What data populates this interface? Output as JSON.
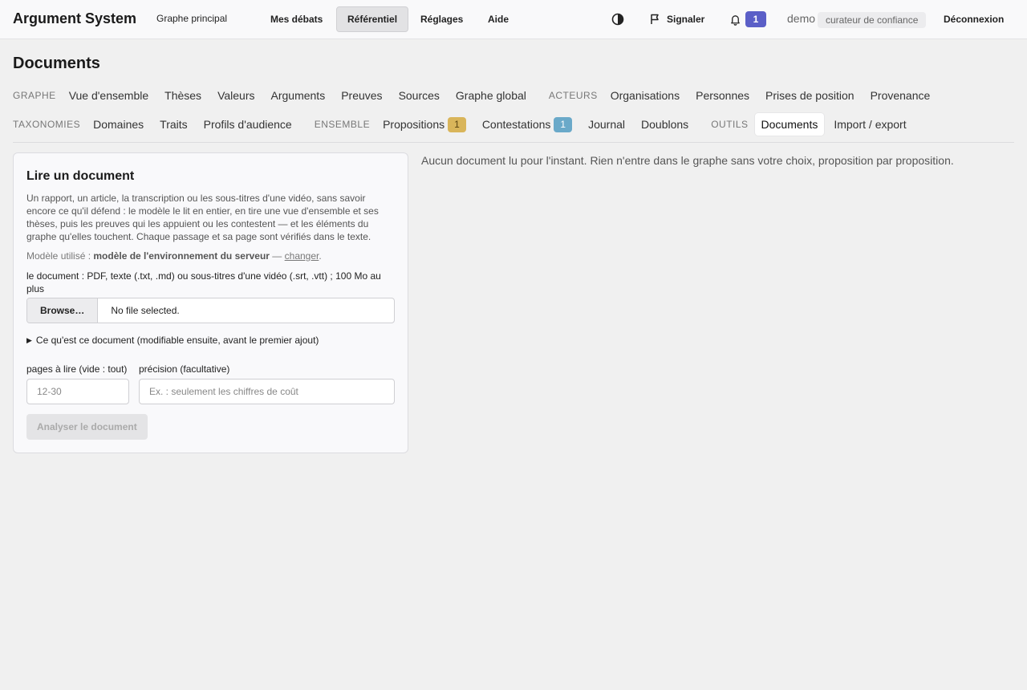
{
  "header": {
    "brand": "Argument System",
    "graph_link": "Graphe principal",
    "nav": [
      {
        "label": "Mes débats"
      },
      {
        "label": "Référentiel"
      },
      {
        "label": "Réglages"
      },
      {
        "label": "Aide"
      }
    ],
    "report_label": "Signaler",
    "notif_count": "1",
    "user": "demo",
    "role": "curateur de confiance",
    "logout": "Déconnexion"
  },
  "page": {
    "title": "Documents"
  },
  "sections": {
    "graphe": {
      "label": "GRAPHE",
      "items": [
        "Vue d'ensemble",
        "Thèses",
        "Valeurs",
        "Arguments",
        "Preuves",
        "Sources",
        "Graphe global"
      ]
    },
    "acteurs": {
      "label": "ACTEURS",
      "items": [
        "Organisations",
        "Personnes",
        "Prises de position",
        "Provenance"
      ]
    },
    "taxonomies": {
      "label": "TAXONOMIES",
      "items": [
        "Domaines",
        "Traits",
        "Profils d'audience"
      ]
    },
    "ensemble": {
      "label": "ENSEMBLE",
      "propositions": "Propositions",
      "propositions_count": "1",
      "contestations": "Contestations",
      "contestations_count": "1",
      "journal": "Journal",
      "doublons": "Doublons"
    },
    "outils": {
      "label": "OUTILS",
      "items": [
        "Documents",
        "Import / export"
      ]
    }
  },
  "colors": {
    "accent": "#5b5fc7",
    "propositions_badge": "#d9b55a",
    "contestations_badge": "#6aa9c9"
  },
  "card": {
    "title": "Lire un document",
    "description": "Un rapport, un article, la transcription ou les sous-titres d'une vidéo, sans savoir encore ce qu'il défend : le modèle le lit en entier, en tire une vue d'ensemble et ses thèses, puis les preuves qui les appuient ou les contestent — et les éléments du graphe qu'elles touchent. Chaque passage et sa page sont vérifiés dans le texte.",
    "model_prefix": "Modèle utilisé : ",
    "model_name": "modèle de l'environnement du serveur",
    "model_sep": " — ",
    "model_change": "changer",
    "model_suffix": ".",
    "file_label": "le document : PDF, texte (.txt, .md) ou sous-titres d'une vidéo (.srt, .vtt) ; 100 Mo au plus",
    "browse": "Browse…",
    "no_file": "No file selected.",
    "details_summary": "Ce qu'est ce document (modifiable ensuite, avant le premier ajout)",
    "pages_label": "pages à lire (vide : tout)",
    "pages_placeholder": "12-30",
    "precision_label": "précision (facultative)",
    "precision_placeholder": "Ex. : seulement les chiffres de coût",
    "submit": "Analyser le document"
  },
  "empty_message": "Aucun document lu pour l'instant. Rien n'entre dans le graphe sans votre choix, proposition par proposition."
}
